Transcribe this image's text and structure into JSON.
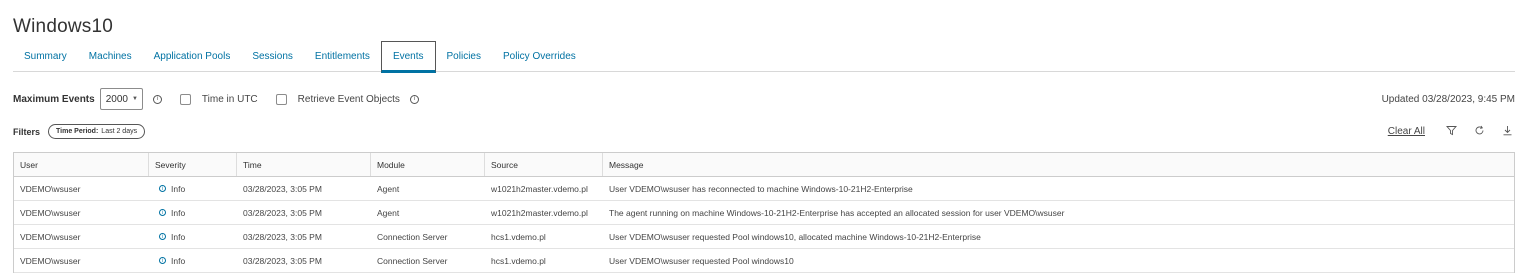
{
  "page": {
    "title": "Windows10"
  },
  "tabs": [
    {
      "label": "Summary"
    },
    {
      "label": "Machines"
    },
    {
      "label": "Application Pools"
    },
    {
      "label": "Sessions"
    },
    {
      "label": "Entitlements"
    },
    {
      "label": "Events",
      "active": true
    },
    {
      "label": "Policies"
    },
    {
      "label": "Policy Overrides"
    }
  ],
  "options": {
    "max_events_label": "Maximum Events",
    "max_events_value": "2000",
    "time_utc_label": "Time in UTC",
    "time_utc_checked": false,
    "retrieve_label": "Retrieve Event Objects",
    "retrieve_checked": false
  },
  "updated": "Updated 03/28/2023, 9:45 PM",
  "filters": {
    "label": "Filters",
    "chip_key": "Time Period:",
    "chip_value": "Last 2 days"
  },
  "actions": {
    "clear_all": "Clear All"
  },
  "table": {
    "headers": [
      "User",
      "Severity",
      "Time",
      "Module",
      "Source",
      "Message"
    ],
    "rows": [
      {
        "user": "VDEMO\\wsuser",
        "severity": "Info",
        "time": "03/28/2023, 3:05 PM",
        "module": "Agent",
        "source": "w1021h2master.vdemo.pl",
        "message": "User VDEMO\\wsuser has reconnected to machine Windows-10-21H2-Enterprise"
      },
      {
        "user": "VDEMO\\wsuser",
        "severity": "Info",
        "time": "03/28/2023, 3:05 PM",
        "module": "Agent",
        "source": "w1021h2master.vdemo.pl",
        "message": "The agent running on machine Windows-10-21H2-Enterprise has accepted an allocated session for user VDEMO\\wsuser"
      },
      {
        "user": "VDEMO\\wsuser",
        "severity": "Info",
        "time": "03/28/2023, 3:05 PM",
        "module": "Connection Server",
        "source": "hcs1.vdemo.pl",
        "message": "User VDEMO\\wsuser requested Pool windows10, allocated machine Windows-10-21H2-Enterprise"
      },
      {
        "user": "VDEMO\\wsuser",
        "severity": "Info",
        "time": "03/28/2023, 3:05 PM",
        "module": "Connection Server",
        "source": "hcs1.vdemo.pl",
        "message": "User VDEMO\\wsuser requested Pool windows10"
      }
    ]
  },
  "colors": {
    "accent": "#0072a3",
    "text": "#333333",
    "border": "#cccccc"
  }
}
